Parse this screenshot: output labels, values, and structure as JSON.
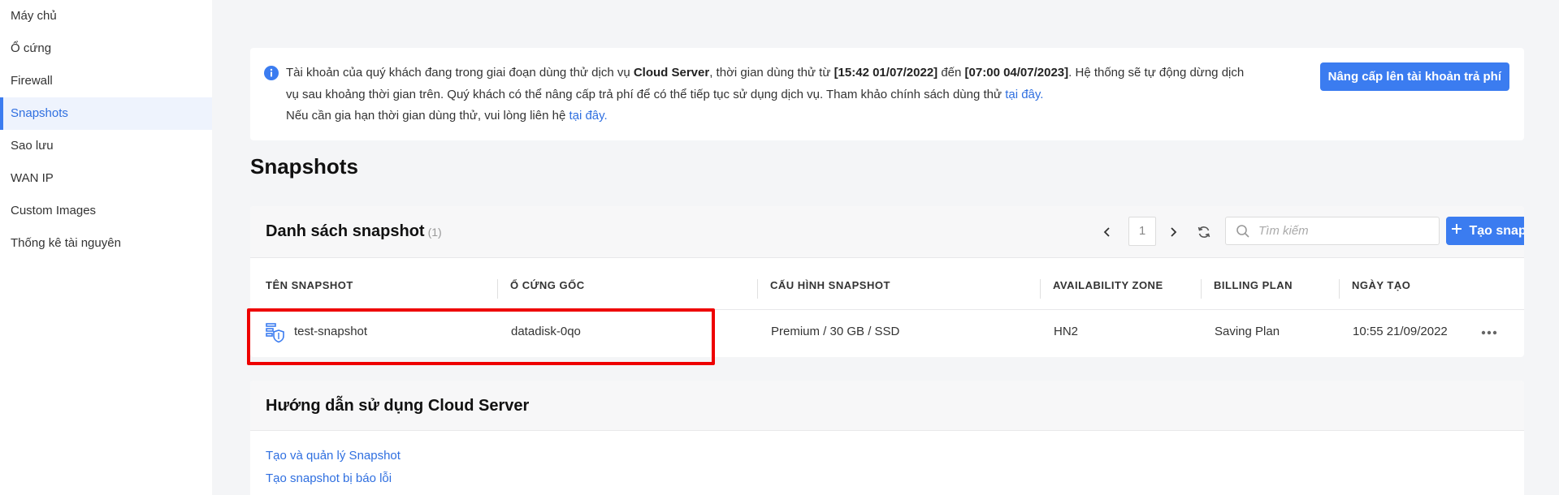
{
  "sidebar": {
    "items": [
      {
        "label": "Máy chủ"
      },
      {
        "label": "Ổ cứng"
      },
      {
        "label": "Firewall"
      },
      {
        "label": "Snapshots"
      },
      {
        "label": "Sao lưu"
      },
      {
        "label": "WAN IP"
      },
      {
        "label": "Custom Images"
      },
      {
        "label": "Thống kê tài nguyên"
      }
    ]
  },
  "notice": {
    "t1": "Tài khoản của quý khách đang trong giai đoạn dùng thử dịch vụ ",
    "service": "Cloud Server",
    "t2": ", thời gian dùng thử từ ",
    "start": "[15:42 01/07/2022]",
    "t3": " đến ",
    "end": "[07:00 04/07/2023]",
    "t4": ". Hệ thống sẽ tự động dừng dịch vụ sau khoảng thời gian trên. Quý khách có thể nâng cấp trả phí để có thể tiếp tục sử dụng dịch vụ. Tham khảo chính sách dùng thử ",
    "link1": "tại đây.",
    "t5": "Nếu cần gia hạn thời gian dùng thử, vui lòng liên hệ ",
    "link2": "tại đây.",
    "upgrade_label": "Nâng cấp lên tài khoản trả phí"
  },
  "page_title": "Snapshots",
  "panel": {
    "title": "Danh sách snapshot",
    "count": "(1)",
    "page": "1",
    "search_placeholder": "Tìm kiếm",
    "create_label": "Tạo snapshot",
    "columns": [
      "TÊN SNAPSHOT",
      "Ổ CỨNG GỐC",
      "CẤU HÌNH SNAPSHOT",
      "AVAILABILITY ZONE",
      "BILLING PLAN",
      "NGÀY TẠO"
    ],
    "rows": [
      {
        "name": "test-snapshot",
        "disk": "datadisk-0qo",
        "config": "Premium / 30 GB / SSD",
        "zone": "HN2",
        "plan": "Saving Plan",
        "created": "10:55 21/09/2022"
      }
    ]
  },
  "guide": {
    "title": "Hướng dẫn sử dụng Cloud Server",
    "links": [
      "Tạo và quản lý Snapshot",
      "Tạo snapshot bị báo lỗi"
    ]
  },
  "colors": {
    "accent": "#3b7cf0",
    "link": "#2f6fe0",
    "highlight": "#ee0000"
  }
}
